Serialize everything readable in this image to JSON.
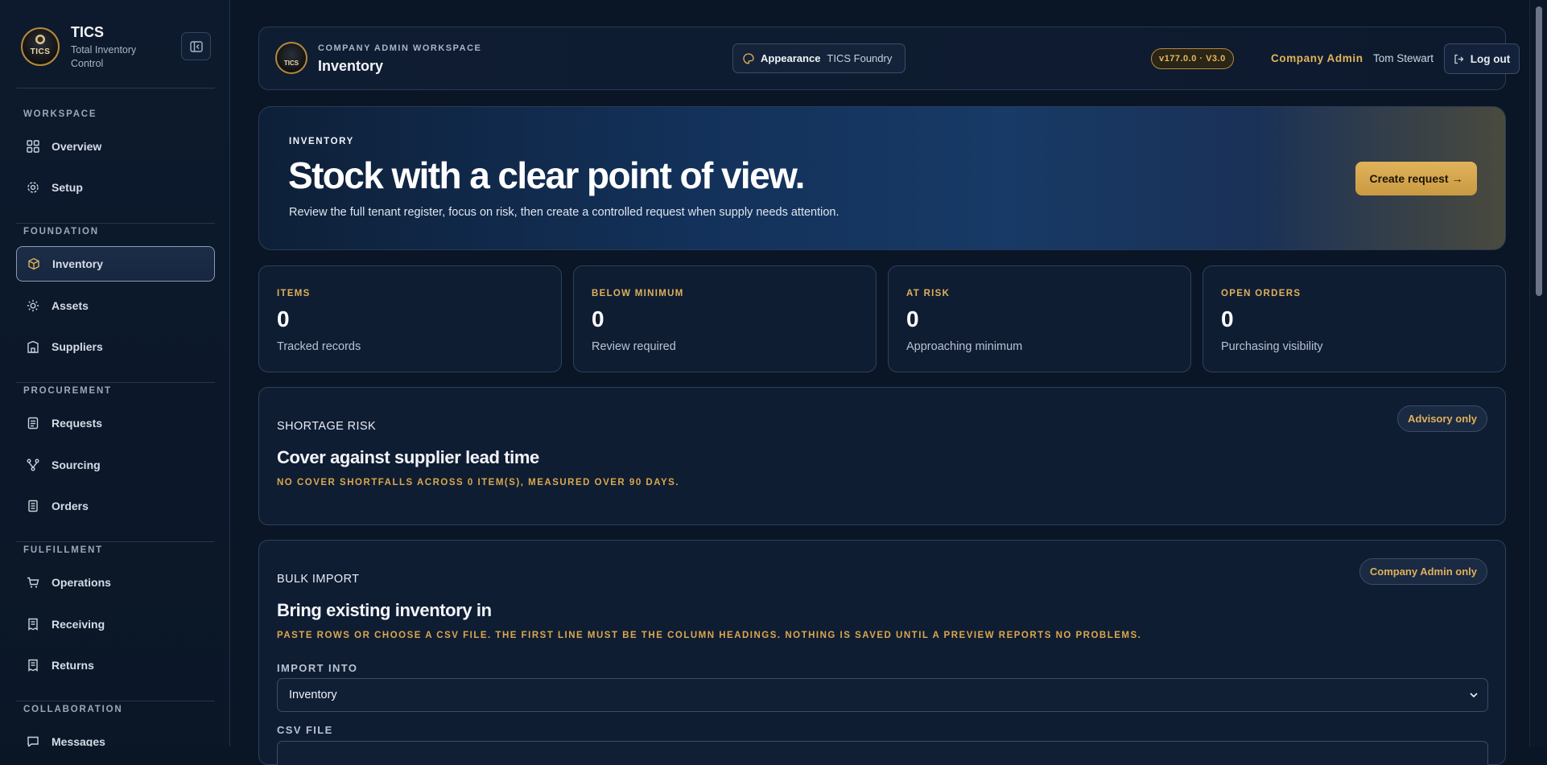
{
  "brand": {
    "name": "TICS",
    "subtitle": "Total Inventory Control",
    "logo_text": "TICS"
  },
  "sidebar": {
    "sections": [
      {
        "title": "WORKSPACE",
        "items": [
          {
            "label": "Overview",
            "icon": "grid-icon"
          },
          {
            "label": "Setup",
            "icon": "gear-icon"
          }
        ]
      },
      {
        "title": "FOUNDATION",
        "items": [
          {
            "label": "Inventory",
            "icon": "box-icon",
            "active": true
          },
          {
            "label": "Assets",
            "icon": "sun-icon"
          },
          {
            "label": "Suppliers",
            "icon": "building-icon"
          }
        ]
      },
      {
        "title": "PROCUREMENT",
        "items": [
          {
            "label": "Requests",
            "icon": "document-icon"
          },
          {
            "label": "Sourcing",
            "icon": "branch-icon"
          },
          {
            "label": "Orders",
            "icon": "clipboard-icon"
          }
        ]
      },
      {
        "title": "FULFILLMENT",
        "items": [
          {
            "label": "Operations",
            "icon": "cart-icon"
          },
          {
            "label": "Receiving",
            "icon": "receipt-icon"
          },
          {
            "label": "Returns",
            "icon": "receipt-icon"
          }
        ]
      },
      {
        "title": "COLLABORATION",
        "items": [
          {
            "label": "Messages",
            "icon": "chat-icon"
          }
        ]
      }
    ]
  },
  "topbar": {
    "kicker": "COMPANY ADMIN WORKSPACE",
    "title": "Inventory",
    "appearance_label": "Appearance",
    "appearance_value": "TICS Foundry",
    "version": "v177.0.0 · V3.0",
    "role": "Company Admin",
    "user": "Tom Stewart",
    "logout": "Log out"
  },
  "hero": {
    "kicker": "INVENTORY",
    "title": "Stock with a clear point of view.",
    "subtitle": "Review the full tenant register, focus on risk, then create a controlled request when supply needs attention.",
    "cta": "Create request →"
  },
  "stats": [
    {
      "label": "ITEMS",
      "value": "0",
      "desc": "Tracked records"
    },
    {
      "label": "BELOW MINIMUM",
      "value": "0",
      "desc": "Review required"
    },
    {
      "label": "AT RISK",
      "value": "0",
      "desc": "Approaching minimum"
    },
    {
      "label": "OPEN ORDERS",
      "value": "0",
      "desc": "Purchasing visibility"
    }
  ],
  "shortage": {
    "kicker": "SHORTAGE RISK",
    "title": "Cover against supplier lead time",
    "note": "NO COVER SHORTFALLS ACROSS 0 ITEM(S), MEASURED OVER 90 DAYS.",
    "badge": "Advisory only"
  },
  "bulk": {
    "kicker": "BULK IMPORT",
    "title": "Bring existing inventory in",
    "note": "PASTE ROWS OR CHOOSE A CSV FILE. THE FIRST LINE MUST BE THE COLUMN HEADINGS. NOTHING IS SAVED UNTIL A PREVIEW REPORTS NO PROBLEMS.",
    "badge": "Company Admin only",
    "import_label": "IMPORT INTO",
    "import_value": "Inventory",
    "csv_label": "CSV FILE"
  },
  "colors": {
    "accent": "#e0b05a",
    "background": "#0a1526",
    "panel": "#0f1d33"
  }
}
